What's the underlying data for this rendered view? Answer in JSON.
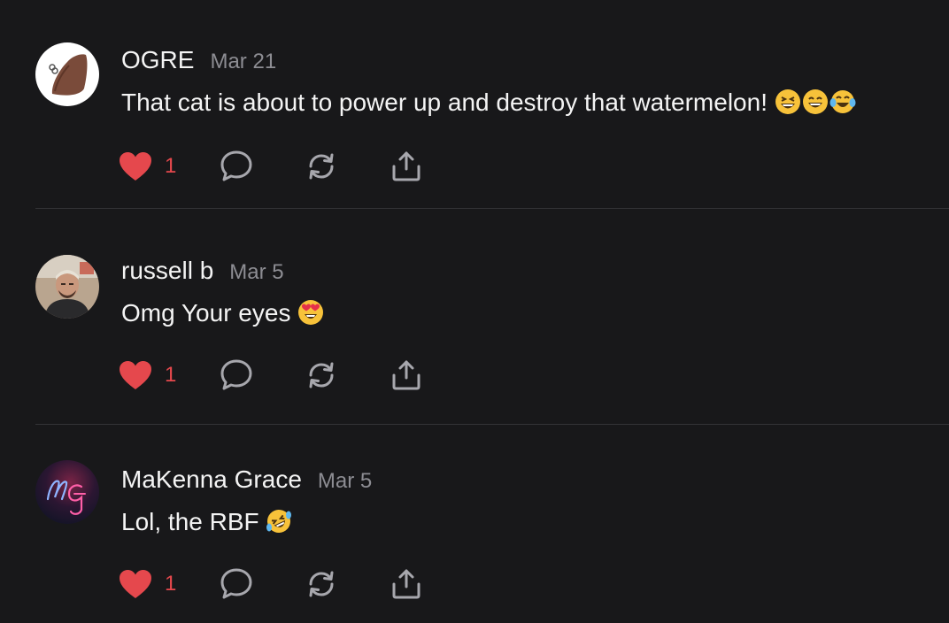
{
  "comments": [
    {
      "author": "OGRE",
      "date": "Mar 21",
      "text": "That cat is about to power up and destroy that watermelon!",
      "emojis": [
        "grinning-squinting-face",
        "grinning-face-smiling-eyes",
        "face-tears-of-joy"
      ],
      "likes": "1",
      "avatar": "ogre-avatar"
    },
    {
      "author": "russell b",
      "date": "Mar 5",
      "text": "Omg Your eyes",
      "emojis": [
        "heart-eyes-face"
      ],
      "likes": "1",
      "avatar": "russell-avatar"
    },
    {
      "author": "MaKenna Grace",
      "date": "Mar 5",
      "text": "Lol, the RBF",
      "emojis": [
        "rolling-on-floor-laughing-face"
      ],
      "likes": "1",
      "avatar": "makenna-avatar"
    }
  ],
  "icons": {
    "like": "heart-icon",
    "reply": "speech-bubble-icon",
    "repost": "repost-icon",
    "share": "share-icon"
  },
  "colors": {
    "background": "#18181a",
    "like": "#e5484d",
    "muted": "#8d8d93",
    "divider": "#333336",
    "icon": "#a7a7ad"
  }
}
